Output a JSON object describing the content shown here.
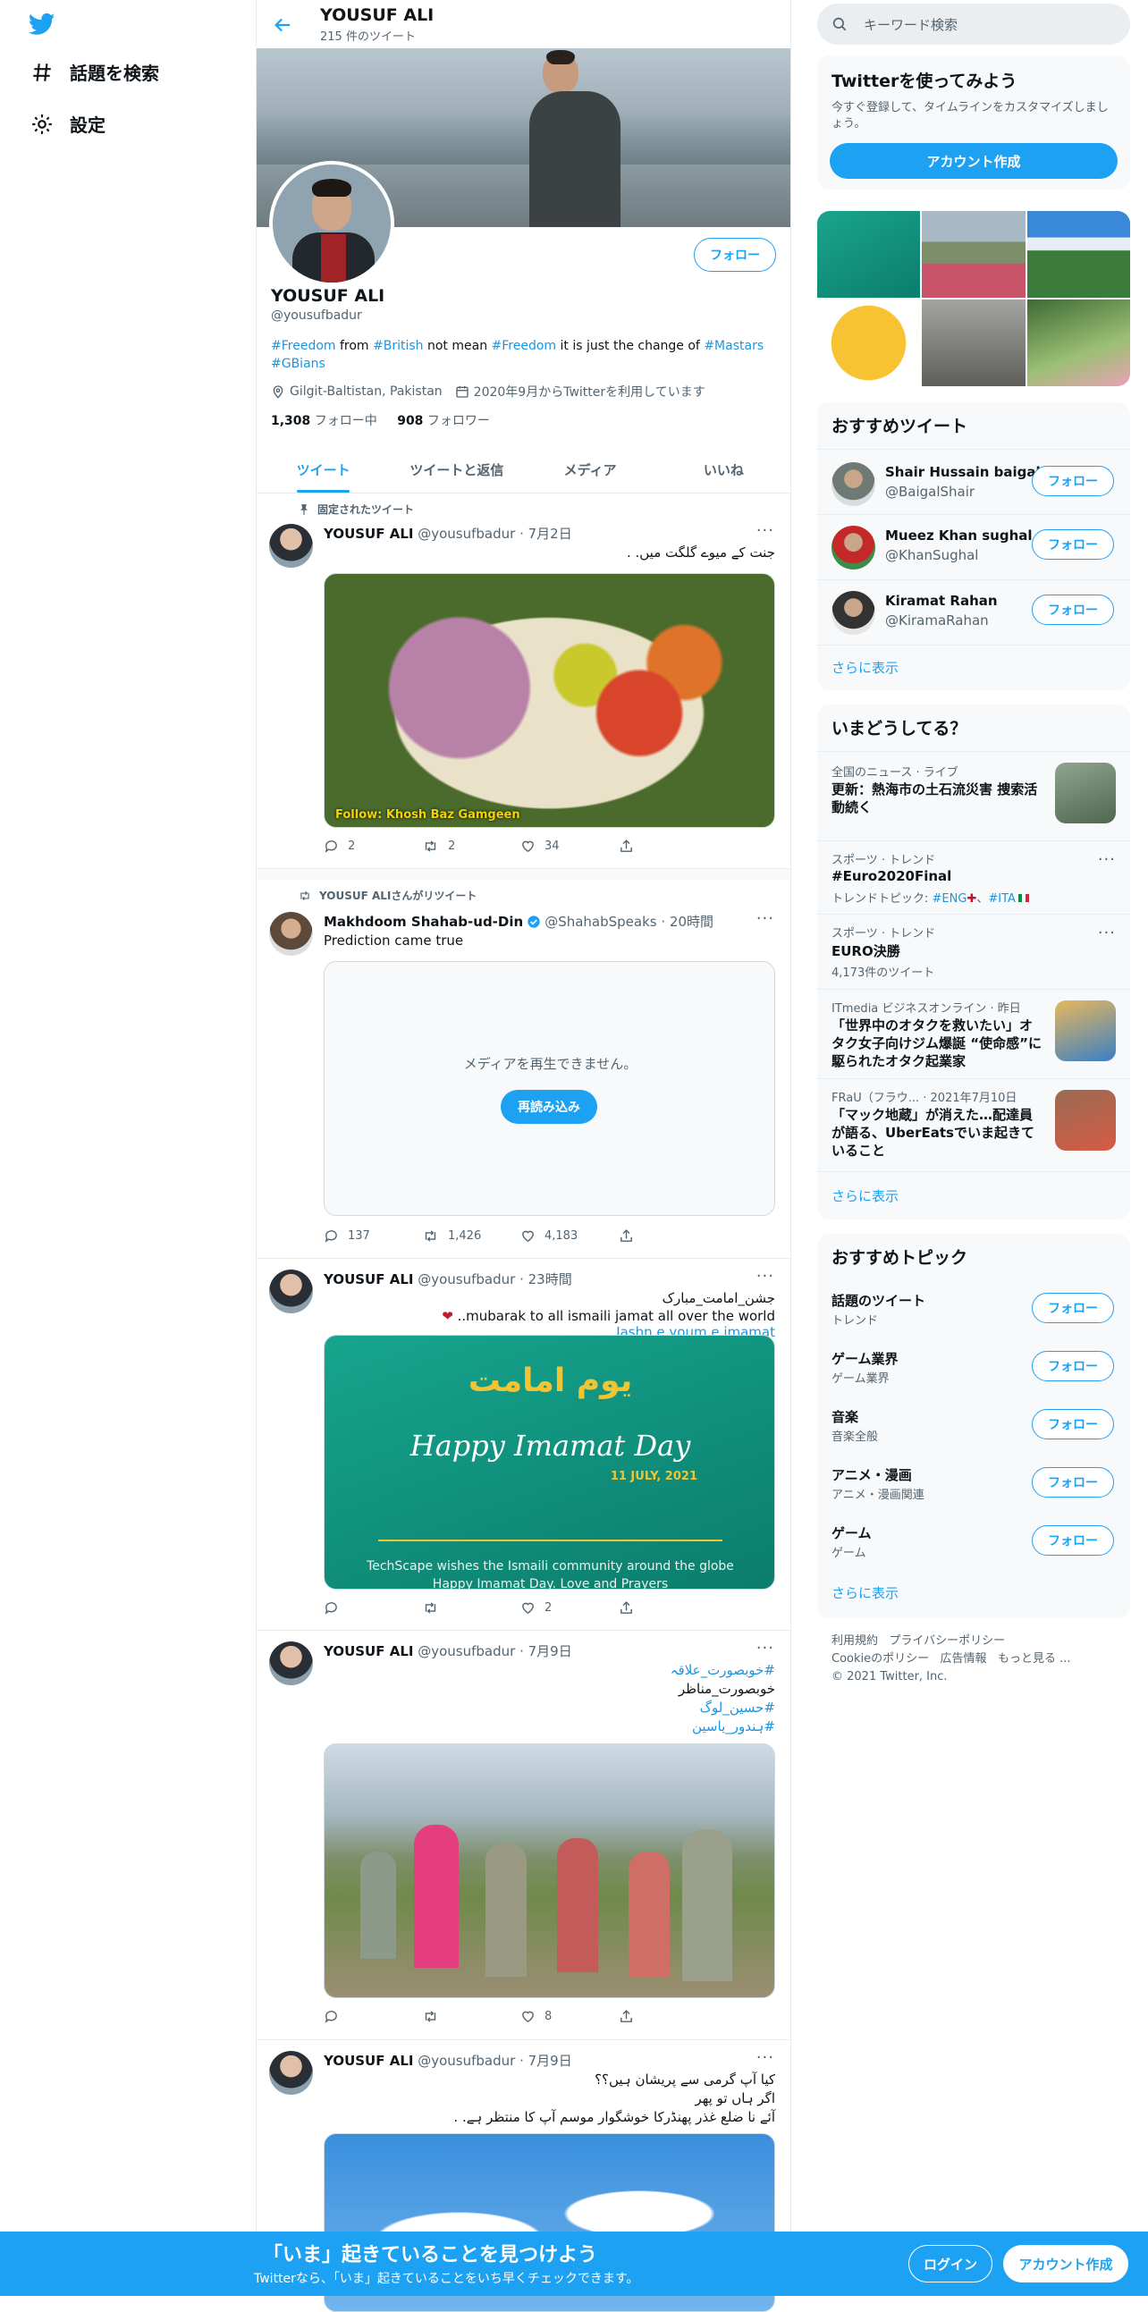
{
  "nav": {
    "explore_label": "話題を検索",
    "settings_label": "設定"
  },
  "header": {
    "name": "YOUSUF ALI",
    "tweet_count": "215 件のツイート"
  },
  "profile": {
    "name": "YOUSUF ALI",
    "handle": "@yousufbadur",
    "follow_label": "フォロー",
    "bio": {
      "t1": "#Freedom",
      "t2": " from ",
      "t3": "#British",
      "t4": " not mean ",
      "t5": "#Freedom",
      "t6": " it is just the change of ",
      "t7": "#Mastars",
      "t8": "#GBians"
    },
    "location": "Gilgit-Baltistan, Pakistan",
    "joined": "2020年9月からTwitterを利用しています",
    "following_count": "1,308",
    "following_label": "フォロー中",
    "followers_count": "908",
    "followers_label": "フォロワー"
  },
  "tabs": [
    "ツイート",
    "ツイートと返信",
    "メディア",
    "いいね"
  ],
  "tweets": [
    {
      "pinned_label": "固定されたツイート",
      "name": "YOUSUF ALI",
      "handle": "@yousufbadur",
      "time": "7月2日",
      "text": "جنت کے میوے گلگت میں. .",
      "media_caption": "Follow: Khosh Baz Gamgeen",
      "reply": "2",
      "retweet": "2",
      "like": "34"
    },
    {
      "retweet_label": "YOUSUF ALIさんがリツイート",
      "name": "Makhdoom Shahab-ud-Din",
      "handle": "@ShahabSpeaks",
      "time": "20時間",
      "text": "Prediction came true",
      "media_error": "メディアを再生できません。",
      "reload_label": "再読み込み",
      "reply": "137",
      "retweet": "1,426",
      "like": "4,183"
    },
    {
      "name": "YOUSUF ALI",
      "handle": "@yousufbadur",
      "time": "23時間",
      "line1": "جشن_امامت_مبارک",
      "line2": "..mubarak to all ismaili jamat all over the world",
      "link": "Jashn.e.youm.e.imamat",
      "card_title_ur": "یوم امامت",
      "card_title_en": "Happy Imamat Day",
      "card_date": "11 JULY, 2021",
      "card_caption1": "TechScape wishes the Ismaili community around the globe",
      "card_caption2": "Happy Imamat Day. Love and Prayers",
      "like": "2"
    },
    {
      "name": "YOUSUF ALI",
      "handle": "@yousufbadur",
      "time": "7月9日",
      "l1": "#خوبصورت_علاقہ",
      "l2": "خوبصورت_مناظر",
      "l3": "#حسین_لوگ",
      "l4": "#ہندور_یاسین",
      "like": "8"
    },
    {
      "name": "YOUSUF ALI",
      "handle": "@yousufbadur",
      "time": "7月9日",
      "l1": "کیا آپ گرمی سے پریشان ہیں؟؟",
      "l2": "اگر ہاں تو پھر",
      "l3": "آئے نا ضلع غذر پھنڈرکا خوشگوار موسم آپ کا منتظر ہے. ."
    }
  ],
  "right": {
    "search_placeholder": "キーワード検索",
    "signup": {
      "title": "Twitterを使ってみよう",
      "desc": "今すぐ登録して、タイムラインをカスタマイズしましょう。",
      "button": "アカウント作成"
    },
    "who": {
      "title": "おすすめツイート",
      "follow": "フォロー",
      "more": "さらに表示",
      "users": [
        {
          "name": "Shair Hussain baigal",
          "handle": "@BaigalShair"
        },
        {
          "name": "Mueez Khan sughal",
          "handle": "@KhanSughal"
        },
        {
          "name": "Kiramat Rahan",
          "handle": "@KiramaRahan"
        }
      ]
    },
    "trends": {
      "title": "いまどうしてる？",
      "more": "さらに表示",
      "items": [
        {
          "meta": "全国のニュース · ライブ",
          "title": "更新：熱海市の土石流災害 捜索活動続く"
        },
        {
          "meta": "スポーツ · トレンド",
          "title": "#Euro2020Final",
          "sub_label": "トレンドトピック:",
          "sub1": "#ENG",
          "sub2": "#ITA"
        },
        {
          "meta": "スポーツ · トレンド",
          "title": "EURO決勝",
          "sub": "4,173件のツイート"
        },
        {
          "meta": "ITmedia ビジネスオンライン · 昨日",
          "title": "「世界中のオタクを救いたい」オタク女子向けジム爆誕 “使命感”に駆られたオタク起業家"
        },
        {
          "meta": "FRaU（フラウ... · 2021年7月10日",
          "title": "「マック地蔵」が消えた…配達員が語る、UberEatsでいま起きていること"
        }
      ]
    },
    "topics": {
      "title": "おすすめトピック",
      "follow": "フォロー",
      "more": "さらに表示",
      "items": [
        {
          "name": "話題のツイート",
          "cat": "トレンド"
        },
        {
          "name": "ゲーム業界",
          "cat": "ゲーム業界"
        },
        {
          "name": "音楽",
          "cat": "音楽全般"
        },
        {
          "name": "アニメ・漫画",
          "cat": "アニメ・漫画関連"
        },
        {
          "name": "ゲーム",
          "cat": "ゲーム"
        }
      ]
    },
    "footer": {
      "terms": "利用規約",
      "privacy": "プライバシーポリシー",
      "cookie": "Cookieのポリシー",
      "ads": "広告情報",
      "more": "もっと見る ...",
      "copyright": "© 2021 Twitter, Inc."
    }
  },
  "bottom": {
    "title": "「いま」起きていることを見つけよう",
    "subtitle": "Twitterなら、「いま」起きていることをいち早くチェックできます。",
    "login": "ログイン",
    "signup": "アカウント作成"
  }
}
